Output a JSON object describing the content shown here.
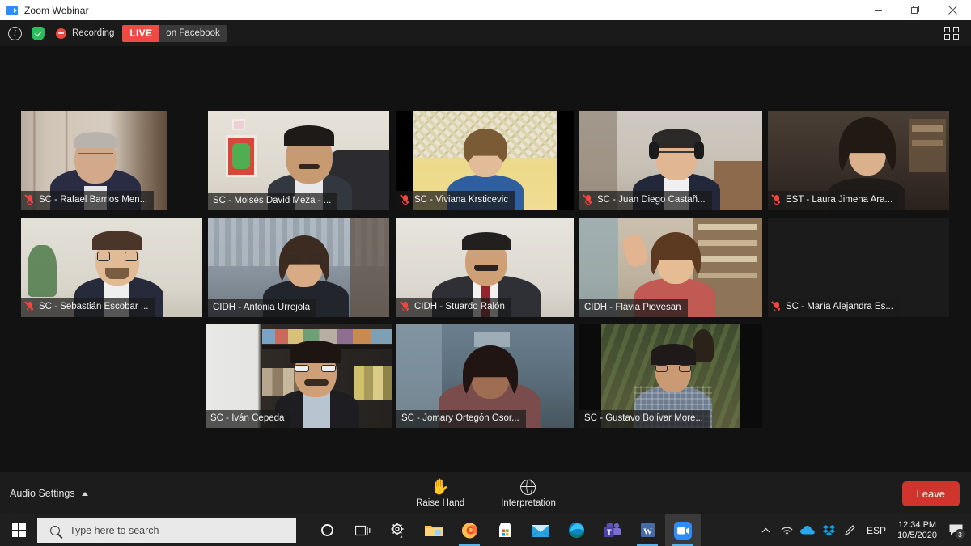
{
  "window": {
    "title": "Zoom Webinar",
    "app_icon": "zoom-camera-icon",
    "minimize_label": "—",
    "restore_label": "❐",
    "close_label": "✕"
  },
  "status_bar": {
    "info_icon": "info-icon",
    "encryption_icon": "shield-check-icon",
    "recording_icon": "recording-icon",
    "recording_label": "Recording",
    "live_label": "LIVE",
    "streaming_target": "on Facebook",
    "fullscreen_icon": "enter-fullscreen-icon"
  },
  "gallery": {
    "rows": [
      [
        {
          "name": "SC - Rafael Barrios Men...",
          "muted": true,
          "active": false,
          "half_active": false
        },
        {
          "name": "SC - Moisés David Meza - ...",
          "muted": false,
          "active": false,
          "half_active": false
        },
        {
          "name": "SC - Viviana Krsticevic",
          "muted": true,
          "active": false,
          "half_active": false
        },
        {
          "name": "SC - Juan Diego Castañ...",
          "muted": true,
          "active": false,
          "half_active": false
        },
        {
          "name": "EST - Laura Jimena Ara...",
          "muted": true,
          "active": false,
          "half_active": false
        }
      ],
      [
        {
          "name": "SC - Sebastián Escobar ...",
          "muted": true,
          "active": false,
          "half_active": false
        },
        {
          "name": "CIDH - Antonia Urrejola",
          "muted": false,
          "active": false,
          "half_active": true
        },
        {
          "name": "CIDH - Stuardo Ralón",
          "muted": true,
          "active": false,
          "half_active": false
        },
        {
          "name": "CIDH - Flávia Piovesan",
          "muted": false,
          "active": false,
          "half_active": true
        },
        {
          "name": "SC - María Alejandra Es...",
          "muted": true,
          "active": false,
          "half_active": false
        }
      ],
      [
        {
          "name": "SC - Iván Cepeda",
          "muted": false,
          "active": true,
          "half_active": false
        },
        {
          "name": "SC  - Jomary Ortegón Osor...",
          "muted": false,
          "active": false,
          "half_active": false
        },
        {
          "name": "SC - Gustavo Bolívar More...",
          "muted": false,
          "active": false,
          "half_active": true
        }
      ]
    ],
    "active_speaker_color": "#d9e64b"
  },
  "toolbar": {
    "audio_settings_label": "Audio Settings",
    "audio_settings_caret": "caret-up-icon",
    "raise_hand_label": "Raise Hand",
    "raise_hand_icon": "raised-hand-icon",
    "interpretation_label": "Interpretation",
    "interpretation_icon": "globe-icon",
    "leave_label": "Leave",
    "leave_color": "#d0342c"
  },
  "taskbar": {
    "start_icon": "windows-start-icon",
    "search_placeholder": "Type here to search",
    "search_icon": "search-icon",
    "apps": [
      {
        "name": "cortana-icon",
        "open": false,
        "active": false
      },
      {
        "name": "task-view-icon",
        "open": false,
        "active": false
      },
      {
        "name": "settings-gear-icon",
        "open": false,
        "active": false
      },
      {
        "name": "file-explorer-icon",
        "open": false,
        "active": false
      },
      {
        "name": "firefox-icon",
        "open": true,
        "active": false
      },
      {
        "name": "microsoft-store-icon",
        "open": false,
        "active": false
      },
      {
        "name": "mail-icon",
        "open": false,
        "active": false
      },
      {
        "name": "microsoft-edge-icon",
        "open": false,
        "active": false
      },
      {
        "name": "microsoft-teams-icon",
        "open": false,
        "active": false
      },
      {
        "name": "microsoft-word-icon",
        "open": true,
        "active": false
      },
      {
        "name": "zoom-icon",
        "open": true,
        "active": true
      }
    ],
    "tray": {
      "chevron_icon": "show-hidden-icons-icon",
      "wifi_icon": "wifi-icon",
      "onedrive_icon": "onedrive-icon",
      "dropbox_icon": "dropbox-icon",
      "pen_icon": "pen-icon",
      "language": "ESP",
      "time": "12:34 PM",
      "date": "10/5/2020",
      "notifications_icon": "action-center-icon",
      "notifications_count": "3"
    }
  }
}
